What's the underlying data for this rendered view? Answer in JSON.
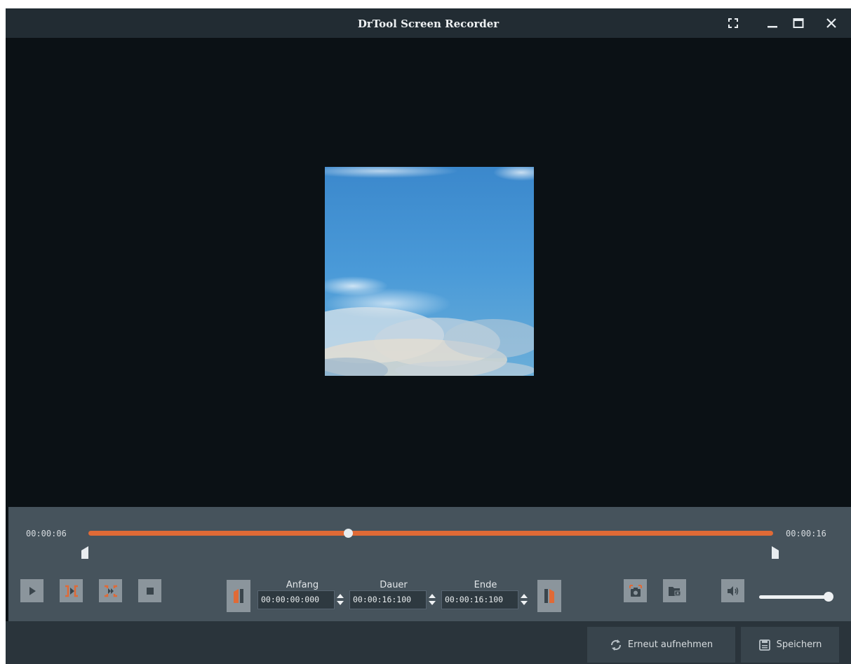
{
  "window": {
    "title": "DrTool Screen Recorder"
  },
  "titlebar_icons": [
    "fullscreen-icon",
    "minimize-icon",
    "maximize-icon",
    "close-icon"
  ],
  "player": {
    "current_time": "00:00:06",
    "total_time": "00:00:16",
    "progress_fraction": 0.38,
    "volume_fraction": 0.95
  },
  "trim": {
    "start_label": "Anfang",
    "start_value": "00:00:00:000",
    "duration_label": "Dauer",
    "duration_value": "00:00:16:100",
    "end_label": "Ende",
    "end_value": "00:00:16:100"
  },
  "footer": {
    "rerecord_label": "Erneut aufnehmen",
    "save_label": "Speichern"
  },
  "colors": {
    "accent": "#e06a36",
    "titlebar": "#222c33",
    "controls_bg": "#46535c",
    "video_bg": "#0b1115"
  }
}
